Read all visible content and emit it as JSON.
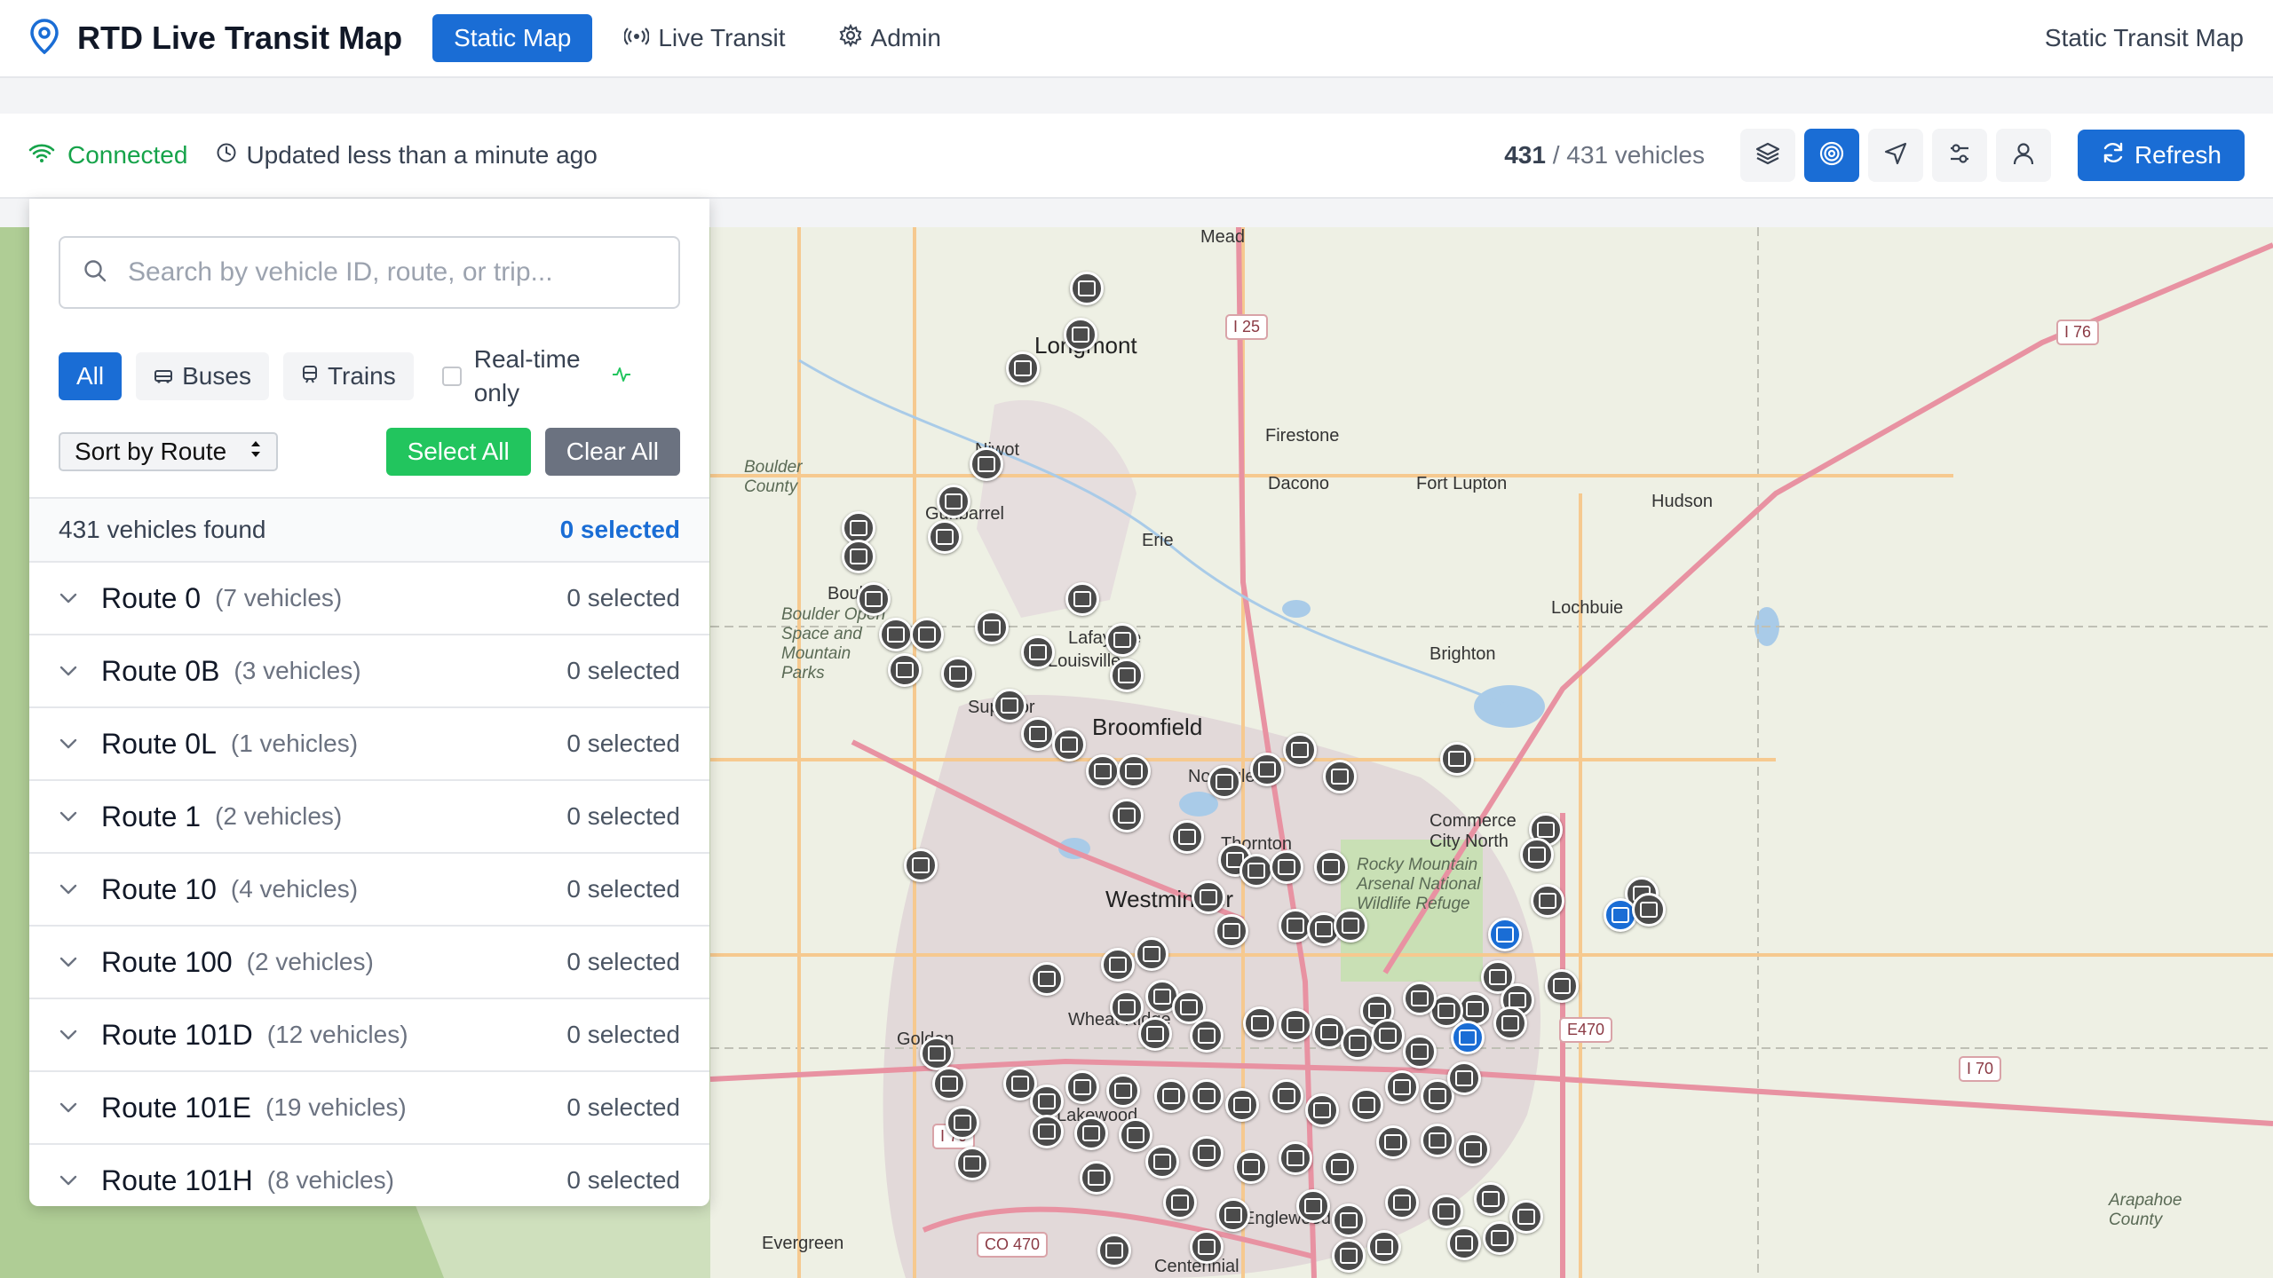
{
  "app": {
    "title": "RTD Live Transit Map"
  },
  "nav": {
    "items": [
      {
        "label": "Static Map",
        "icon": "map-icon"
      },
      {
        "label": "Live Transit",
        "icon": "broadcast-icon"
      },
      {
        "label": "Admin",
        "icon": "gear-icon"
      }
    ],
    "active": "Static Map",
    "right_label": "Static Transit Map"
  },
  "status": {
    "connection": "Connected",
    "updated": "Updated less than a minute ago",
    "vehicles_shown": "431",
    "vehicles_total": "/ 431 vehicles",
    "refresh_label": "Refresh",
    "tools": [
      "layers-icon",
      "target-icon",
      "navigation-icon",
      "sliders-icon",
      "user-icon"
    ]
  },
  "panel": {
    "search_placeholder": "Search by vehicle ID, route, or trip...",
    "filters": {
      "all": "All",
      "buses": "Buses",
      "trains": "Trains",
      "realtime": "Real-time only"
    },
    "sort_label": "Sort by Route",
    "select_all": "Select All",
    "clear_all": "Clear All",
    "found": "431 vehicles found",
    "selected": "0 selected",
    "routes": [
      {
        "name": "Route 0",
        "count": "(7 vehicles)",
        "selected": "0 selected"
      },
      {
        "name": "Route 0B",
        "count": "(3 vehicles)",
        "selected": "0 selected"
      },
      {
        "name": "Route 0L",
        "count": "(1 vehicles)",
        "selected": "0 selected"
      },
      {
        "name": "Route 1",
        "count": "(2 vehicles)",
        "selected": "0 selected"
      },
      {
        "name": "Route 10",
        "count": "(4 vehicles)",
        "selected": "0 selected"
      },
      {
        "name": "Route 100",
        "count": "(2 vehicles)",
        "selected": "0 selected"
      },
      {
        "name": "Route 101D",
        "count": "(12 vehicles)",
        "selected": "0 selected"
      },
      {
        "name": "Route 101E",
        "count": "(19 vehicles)",
        "selected": "0 selected"
      },
      {
        "name": "Route 101H",
        "count": "(8 vehicles)",
        "selected": "0 selected"
      }
    ]
  },
  "map": {
    "places": [
      "Mead",
      "Longmont",
      "Niwot",
      "Firestone",
      "Dacono",
      "Fort Lupton",
      "Hudson",
      "Erie",
      "Lafayette",
      "Louisville",
      "Gunbarrel",
      "Lochbuie",
      "Brighton",
      "Broomfield",
      "Superior",
      "Northglenn",
      "Thornton",
      "Westminster",
      "Commerce City North",
      "Wheat Ridge",
      "Golden",
      "Lakewood",
      "Englewood",
      "Centennial",
      "Evergreen",
      "Boulder"
    ],
    "areas": [
      "Boulder County",
      "Boulder Open Space and Mountain Parks",
      "Rocky Mountain Arsenal National Wildlife Refuge",
      "Arapahoe County"
    ],
    "highways": [
      "I 25",
      "I 76",
      "E470",
      "I 70",
      "I 70",
      "CO 470"
    ],
    "colors": {
      "major_road": "#e892a2",
      "arterial": "#f6c98f",
      "water": "#a9cbe8",
      "park": "#c6dfb2",
      "urban": "#e0d8d8",
      "marker": "#4b4b4b",
      "live_marker": "#1a6dd5"
    }
  }
}
